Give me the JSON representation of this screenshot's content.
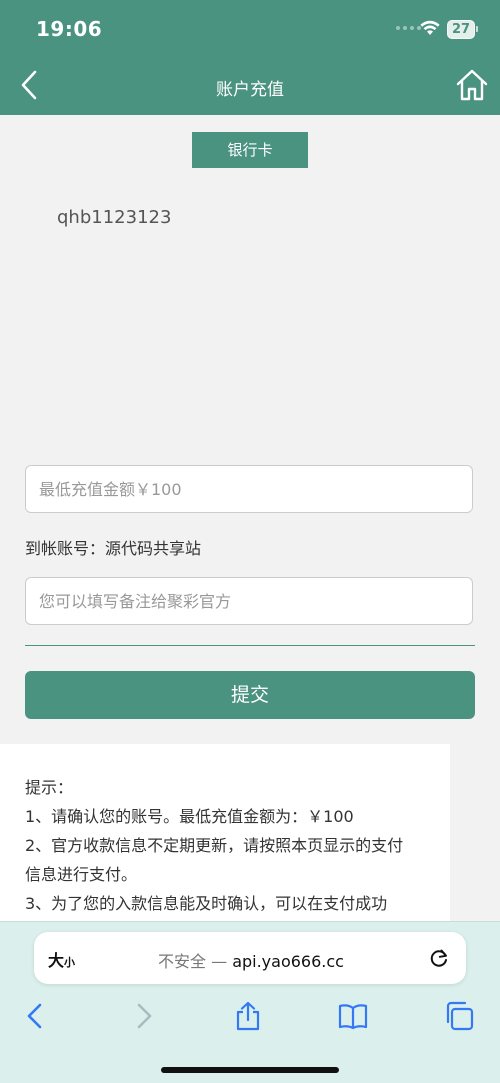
{
  "status_bar": {
    "time": "19:06",
    "battery": "27"
  },
  "nav": {
    "title": "账户充值"
  },
  "tabs": {
    "bank_card": "银行卡"
  },
  "account": {
    "name": "qhb1123123"
  },
  "form": {
    "amount_placeholder": "最低充值金额￥100",
    "dest_account_label": "到帐账号：",
    "dest_account_value": "源代码共享站",
    "remark_placeholder": "您可以填写备注给聚彩官方",
    "submit_label": "提交"
  },
  "tips": {
    "title": "提示：",
    "lines": [
      "1、请确认您的账号。最低充值金额为：￥100",
      "2、官方收款信息不定期更新，请按照本页显示的支付",
      "信息进行支付。",
      "3、为了您的入款信息能及时确认，可以在支付成功"
    ]
  },
  "browser": {
    "text_size_big": "大",
    "text_size_small": "小",
    "security": "不安全 —",
    "domain": "api.yao666.cc"
  },
  "colors": {
    "accent": "#4a9380",
    "browser_bg": "#dbf0ec",
    "icon_blue": "#3478f6"
  },
  "icons": [
    "wifi-icon",
    "battery-icon",
    "back-arrow-icon",
    "home-icon",
    "reload-icon",
    "chevron-left-icon",
    "chevron-right-icon",
    "share-icon",
    "bookmarks-icon",
    "tabs-icon"
  ]
}
